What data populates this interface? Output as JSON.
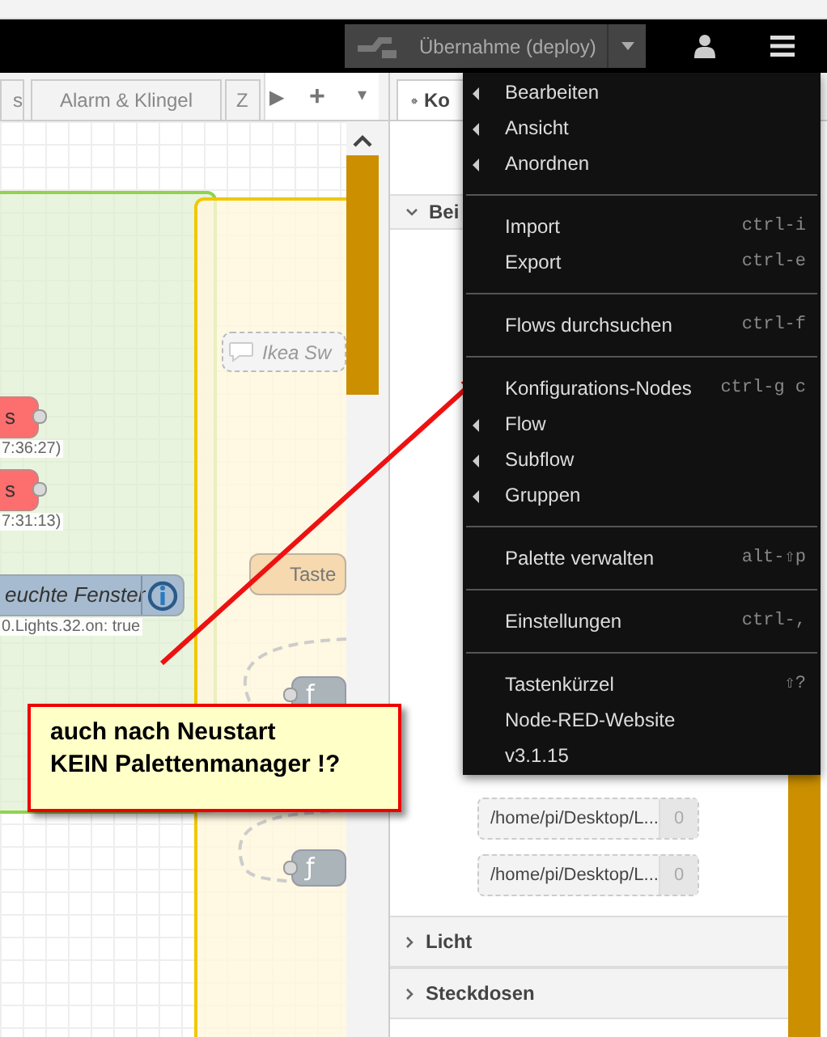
{
  "header": {
    "deploy_button": {
      "label": "Übernahme (deploy)"
    }
  },
  "workspace_tabs": [
    {
      "label": "s",
      "selected": false
    },
    {
      "label": "Alarm & Klingel",
      "selected": false
    },
    {
      "label": "Z",
      "selected": false
    }
  ],
  "tab_controls": [
    "▶",
    "+",
    "▾"
  ],
  "canvas_nodes": [
    {
      "kind": "node",
      "label": "s",
      "color": "#fd6e6e",
      "status": "7:36:27)",
      "info": false
    },
    {
      "kind": "node",
      "label": "s",
      "color": "#fd6e6e",
      "status": "7:31:13)",
      "info": false
    },
    {
      "kind": "node",
      "label": "euchte Fenster",
      "color": "#a6bbcf",
      "status": "0.Lights.32.on: true",
      "info": true
    },
    {
      "kind": "comment",
      "label": "Ikea Sw"
    },
    {
      "kind": "node",
      "label": "Taste",
      "color": "#f6d9ae",
      "info": false
    },
    {
      "kind": "function",
      "label": "ƒ"
    },
    {
      "kind": "function",
      "label": "ƒ"
    }
  ],
  "sidebar": {
    "tab": {
      "label": "Ko",
      "selected": true
    },
    "sections": [
      {
        "label": "Bei",
        "expanded": true,
        "entries": [
          {
            "path": "/home/pi/Desktop/L...",
            "count": "0"
          },
          {
            "path": "/home/pi/Desktop/L...",
            "count": "0"
          }
        ]
      },
      {
        "label": "Licht",
        "expanded": false
      },
      {
        "label": "Steckdosen",
        "expanded": false
      }
    ]
  },
  "menu": [
    {
      "kind": "item",
      "label": "Bearbeiten",
      "submenu": true
    },
    {
      "kind": "item",
      "label": "Ansicht",
      "submenu": true
    },
    {
      "kind": "item",
      "label": "Anordnen",
      "submenu": true
    },
    {
      "kind": "separator"
    },
    {
      "kind": "item",
      "label": "Import",
      "shortcut": "ctrl-i",
      "submenu": false
    },
    {
      "kind": "item",
      "label": "Export",
      "shortcut": "ctrl-e",
      "submenu": false
    },
    {
      "kind": "separator"
    },
    {
      "kind": "item",
      "label": "Flows durchsuchen",
      "shortcut": "ctrl-f",
      "submenu": false
    },
    {
      "kind": "separator"
    },
    {
      "kind": "item",
      "label": "Konfigurations-Nodes",
      "shortcut": "ctrl-g c",
      "submenu": false
    },
    {
      "kind": "item",
      "label": "Flow",
      "submenu": true
    },
    {
      "kind": "item",
      "label": "Subflow",
      "submenu": true
    },
    {
      "kind": "item",
      "label": "Gruppen",
      "submenu": true
    },
    {
      "kind": "separator"
    },
    {
      "kind": "item",
      "label": "Palette verwalten",
      "shortcut": "alt-⇧p",
      "submenu": false
    },
    {
      "kind": "separator"
    },
    {
      "kind": "item",
      "label": "Einstellungen",
      "shortcut": "ctrl-,",
      "submenu": false
    },
    {
      "kind": "separator"
    },
    {
      "kind": "item",
      "label": "Tastenkürzel",
      "shortcut": "⇧?",
      "submenu": false
    },
    {
      "kind": "item",
      "label": "Node-RED-Website",
      "submenu": false
    },
    {
      "kind": "item",
      "label": "v3.1.15",
      "submenu": false
    }
  ],
  "callout": {
    "text": "auch nach Neustart\nKEIN Palettenmanager !?"
  }
}
